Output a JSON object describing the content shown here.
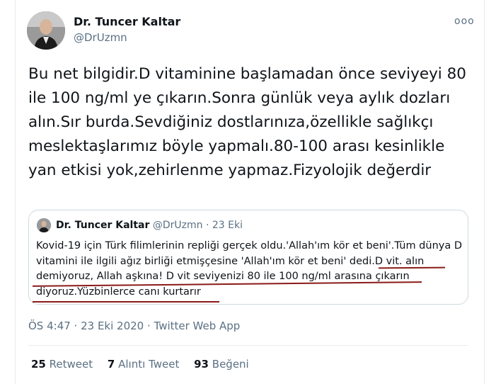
{
  "author": {
    "name": "Dr. Tuncer Kaltar",
    "handle": "@DrUzmn"
  },
  "more_icon": "ooo",
  "tweet_text": "Bu net bilgidir.D vitaminine başlamadan önce seviyeyi 80 ile 100 ng/ml ye çıkarın.Sonra günlük veya aylık dozları alın.Sır burda.Sevdiğiniz dostlarınıza,özellikle sağlıkçı meslektaşlarımız böyle yapmalı.80-100 arası kesinlikle yan etkisi yok,zehirlenme yapmaz.Fizyolojik değerdir",
  "quoted": {
    "name": "Dr. Tuncer Kaltar",
    "handle": "@DrUzmn",
    "separator": "·",
    "date": "23 Eki",
    "text": "Kovid-19 için Türk filimlerinin repliği gerçek oldu.'Allah'ım kör et beni'.Tüm dünya D vitamini ile ilgili ağız birliği etmişçesine 'Allah'ım kör et beni' dedi.D vit. alın demiyoruz, Allah aşkına! D vit seviyenizi 80 ile 100 ng/ml arasına çıkarın diyoruz.Yüzbinlerce canı kurtarır"
  },
  "timestamp": "ÖS 4:47 · 23 Eki 2020 · Twitter Web App",
  "stats": {
    "retweets": {
      "count": "25",
      "label": "Retweet"
    },
    "quotes": {
      "count": "7",
      "label": "Alıntı Tweet"
    },
    "likes": {
      "count": "93",
      "label": "Beğeni"
    }
  },
  "colors": {
    "text": "#0f1419",
    "secondary": "#5b7083",
    "border": "#cfd9de",
    "annotation_red": "#8b1a1a"
  }
}
